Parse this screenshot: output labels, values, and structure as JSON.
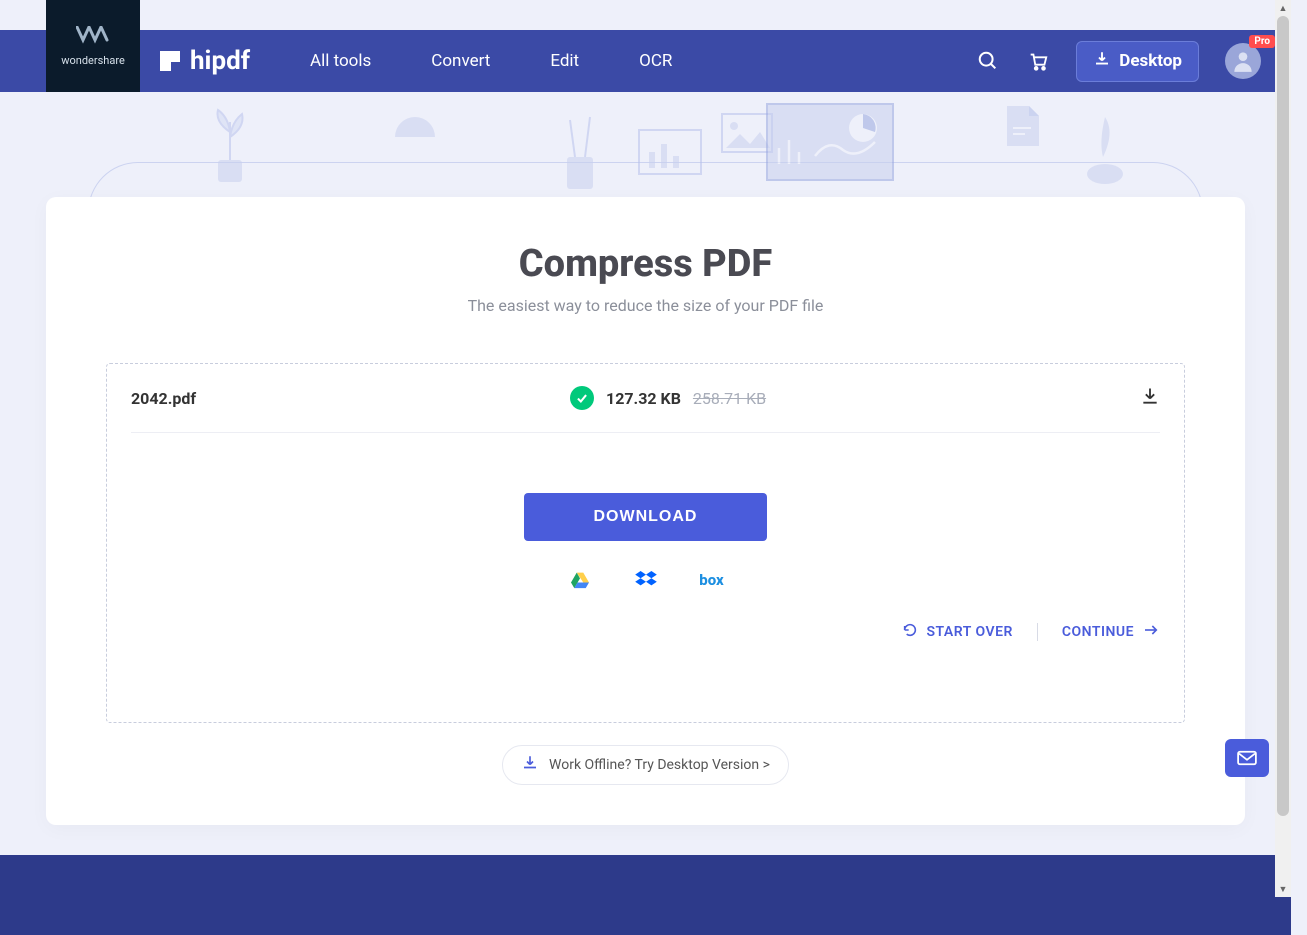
{
  "brand": {
    "wondershare": "wondershare",
    "name": "hipdf"
  },
  "nav": {
    "items": [
      "All tools",
      "Convert",
      "Edit",
      "OCR"
    ],
    "desktop": "Desktop",
    "pro_badge": "Pro"
  },
  "page": {
    "title": "Compress PDF",
    "subtitle": "The easiest way to reduce the size of your PDF file"
  },
  "file": {
    "name": "2042.pdf",
    "compressed_size": "127.32 KB",
    "original_size": "258.71 KB"
  },
  "buttons": {
    "download": "DOWNLOAD",
    "start_over": "START OVER",
    "continue": "CONTINUE",
    "offline": "Work Offline? Try Desktop Version >"
  },
  "cloud_services": [
    "google-drive",
    "dropbox",
    "box"
  ]
}
